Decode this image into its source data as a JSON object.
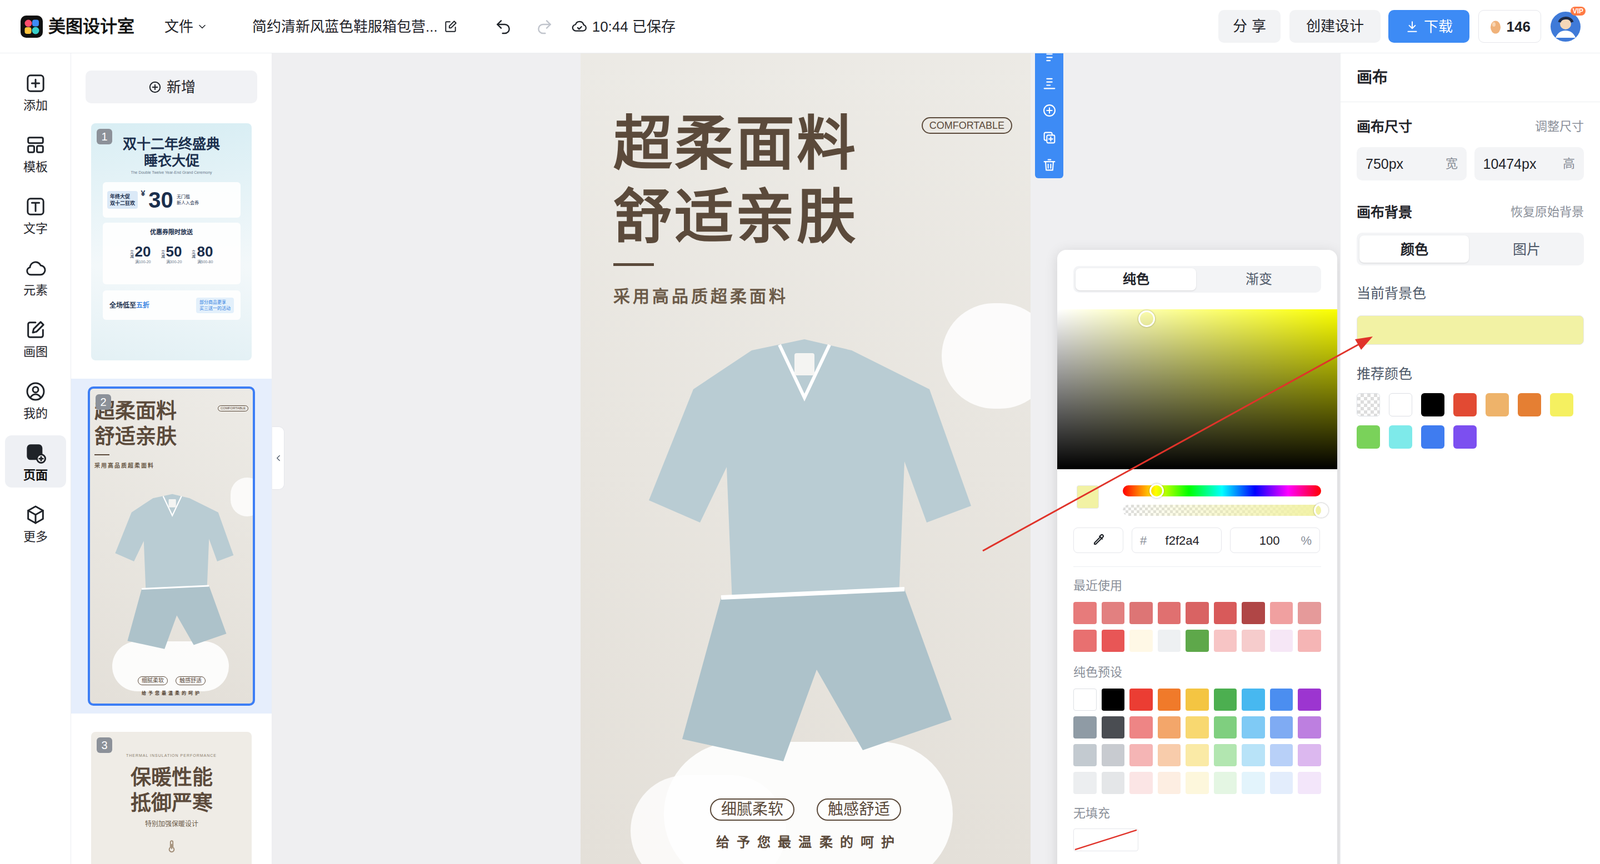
{
  "app": {
    "name": "美图设计室"
  },
  "topbar": {
    "file_menu": "文件",
    "document_title": "简约清新风蓝色鞋服箱包营...",
    "save_status": "10:44 已保存",
    "share": "分 享",
    "create": "创建设计",
    "download": "下载",
    "points": "146",
    "avatar_badge": "VIP"
  },
  "rail": {
    "items": [
      {
        "label": "添加",
        "selected": false
      },
      {
        "label": "模板",
        "selected": false
      },
      {
        "label": "文字",
        "selected": false
      },
      {
        "label": "元素",
        "selected": false
      },
      {
        "label": "画图",
        "selected": false
      },
      {
        "label": "我的",
        "selected": false
      },
      {
        "label": "页面",
        "selected": true
      },
      {
        "label": "更多",
        "selected": false
      }
    ]
  },
  "pages": {
    "add_button": "新增",
    "items": [
      {
        "number": "1",
        "selected": false,
        "kind": "promo",
        "title_lines": [
          "双十二年终盛典",
          "睡衣大促"
        ],
        "subtitle": "The Double Twelve Year-End Grand Ceremony",
        "coupon": {
          "tag_lines": [
            "年终大促",
            "双十二狂欢"
          ],
          "currency": "¥",
          "amount": "30",
          "note_lines": [
            "无门槛",
            "新人入会券"
          ]
        },
        "section": "优惠券限时放送",
        "coupons": [
          {
            "prefix": "立减",
            "amount": "20",
            "condition": "满100-20"
          },
          {
            "prefix": "立减",
            "amount": "50",
            "condition": "满300-20"
          },
          {
            "prefix": "立减",
            "amount": "80",
            "condition": "满500-80"
          }
        ],
        "sale": {
          "text": "全场低至",
          "highlight": "五折",
          "note_lines": [
            "部分商品更享",
            "买三送一的活动"
          ]
        }
      },
      {
        "number": "2",
        "selected": true,
        "kind": "current"
      },
      {
        "number": "3",
        "selected": false,
        "kind": "feature",
        "eyebrow": "THERMAL INSULATION PERFORMANCE",
        "title_lines": [
          "保暖性能",
          "抵御严寒"
        ],
        "subtitle": "特别加强保暖设计"
      }
    ]
  },
  "canvas_design": {
    "title_lines": [
      "超柔面料",
      "舒适亲肤"
    ],
    "badge": "COMFORTABLE",
    "subtitle": "采用高品质超柔面料",
    "tags": [
      "细腻柔软",
      "触感舒适"
    ],
    "slogan": "给予您最温柔的呵护"
  },
  "color_picker": {
    "tabs": [
      {
        "label": "纯色",
        "selected": true
      },
      {
        "label": "渐变",
        "selected": false
      }
    ],
    "sv": {
      "saturation": 0.32,
      "brightness": 0.94
    },
    "hue": {
      "level": 0.17
    },
    "alpha": {
      "level": 1
    },
    "hash": "#",
    "hex": "f2f2a4",
    "opacity": "100",
    "percent": "%",
    "recent_label": "最近使用",
    "recent": [
      {
        "color": "#e77b7b"
      },
      {
        "color": "#e28080"
      },
      {
        "color": "#dd7575"
      },
      {
        "color": "#e07070"
      },
      {
        "color": "#d96363"
      },
      {
        "color": "#d85a5a"
      },
      {
        "color": "#b04646"
      },
      {
        "color": "#f0a0a0"
      },
      {
        "color": "#e59a9a"
      },
      {
        "color": "#e87070"
      },
      {
        "color": "#e85656"
      },
      {
        "color": "#fff8e6"
      },
      {
        "color": "#eef0f2"
      },
      {
        "color": "#5ea84a"
      },
      {
        "color": "#f7c5c5"
      },
      {
        "color": "#f6cccc"
      },
      {
        "color": "#f6e7f6"
      },
      {
        "color": "#f5b5b5"
      }
    ],
    "presets_label": "纯色预设",
    "presets": [
      {
        "color": "#ffffff"
      },
      {
        "color": "#000000"
      },
      {
        "color": "#eb3d33"
      },
      {
        "color": "#f07a2a"
      },
      {
        "color": "#f4c542"
      },
      {
        "color": "#4caf50"
      },
      {
        "color": "#47b8f0"
      },
      {
        "color": "#4b8ef0"
      },
      {
        "color": "#9c35d0"
      },
      {
        "color": "#8f9ba5"
      },
      {
        "color": "#4a4d52"
      },
      {
        "color": "#ee8585"
      },
      {
        "color": "#f3a66a"
      },
      {
        "color": "#f8d870"
      },
      {
        "color": "#7fcf7f"
      },
      {
        "color": "#7fcaf5"
      },
      {
        "color": "#7fabf3"
      },
      {
        "color": "#bd7fe0"
      },
      {
        "color": "#c3cad0"
      },
      {
        "color": "#c8cbd0"
      },
      {
        "color": "#f5b5b5"
      },
      {
        "color": "#f8ccab"
      },
      {
        "color": "#faeaa6"
      },
      {
        "color": "#b2e6b0"
      },
      {
        "color": "#b8e3f8"
      },
      {
        "color": "#b8d0f8"
      },
      {
        "color": "#dcb8ef"
      },
      {
        "color": "#eceef0"
      },
      {
        "color": "#e4e6e8"
      },
      {
        "color": "#fbe5e5"
      },
      {
        "color": "#fdeee2"
      },
      {
        "color": "#fdf7dc"
      },
      {
        "color": "#e4f6e3"
      },
      {
        "color": "#e3f4fc"
      },
      {
        "color": "#e3edfc"
      },
      {
        "color": "#f3e6fa"
      }
    ],
    "no_fill_label": "无填充"
  },
  "right_panel": {
    "title": "画布",
    "size_label": "画布尺寸",
    "resize": "调整尺寸",
    "width": {
      "value": "750px",
      "unit": "宽"
    },
    "height": {
      "value": "10474px",
      "unit": "高"
    },
    "background_label": "画布背景",
    "restore": "恢复原始背景",
    "tabs": [
      {
        "label": "颜色",
        "selected": true
      },
      {
        "label": "图片",
        "selected": false
      }
    ],
    "current_label": "当前背景色",
    "current_color": "#f2f2a4",
    "recommended_label": "推荐颜色",
    "recommended": [
      {
        "kind": "transparent"
      },
      {
        "kind": "solid",
        "color": "#ffffff"
      },
      {
        "kind": "solid",
        "color": "#000000"
      },
      {
        "kind": "solid",
        "color": "#e24a33"
      },
      {
        "kind": "solid",
        "color": "#eeb36a"
      },
      {
        "kind": "solid",
        "color": "#e57f33"
      },
      {
        "kind": "solid",
        "color": "#f5f060"
      },
      {
        "kind": "solid",
        "color": "#7ad25a"
      },
      {
        "kind": "solid",
        "color": "#7eeaea"
      },
      {
        "kind": "solid",
        "color": "#3f7cf0"
      },
      {
        "kind": "solid",
        "color": "#7c4ff0"
      }
    ]
  }
}
